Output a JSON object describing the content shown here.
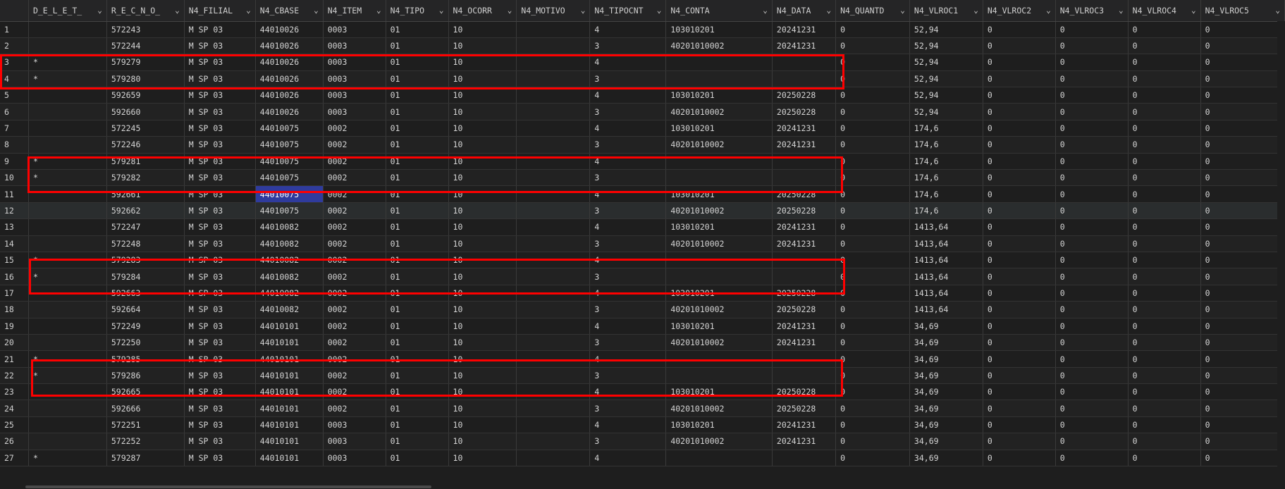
{
  "columns": [
    "",
    "D_E_L_E_T_",
    "R_E_C_N_O_",
    "N4_FILIAL",
    "N4_CBASE",
    "N4_ITEM",
    "N4_TIPO",
    "N4_OCORR",
    "N4_MOTIVO",
    "N4_TIPOCNT",
    "N4_CONTA",
    "N4_DATA",
    "N4_QUANTD",
    "N4_VLROC1",
    "N4_VLROC2",
    "N4_VLROC3",
    "N4_VLROC4",
    "N4_VLROC5"
  ],
  "rows": [
    [
      "1",
      "",
      "572243",
      "M SP 03",
      "44010026",
      "0003",
      "01",
      "10",
      "",
      "4",
      "103010201",
      "20241231",
      "0",
      "52,94",
      "0",
      "0",
      "0",
      "0"
    ],
    [
      "2",
      "",
      "572244",
      "M SP 03",
      "44010026",
      "0003",
      "01",
      "10",
      "",
      "3",
      "40201010002",
      "20241231",
      "0",
      "52,94",
      "0",
      "0",
      "0",
      "0"
    ],
    [
      "3",
      "*",
      "579279",
      "M SP 03",
      "44010026",
      "0003",
      "01",
      "10",
      "",
      "4",
      "",
      "",
      "0",
      "52,94",
      "0",
      "0",
      "0",
      "0"
    ],
    [
      "4",
      "*",
      "579280",
      "M SP 03",
      "44010026",
      "0003",
      "01",
      "10",
      "",
      "3",
      "",
      "",
      "0",
      "52,94",
      "0",
      "0",
      "0",
      "0"
    ],
    [
      "5",
      "",
      "592659",
      "M SP 03",
      "44010026",
      "0003",
      "01",
      "10",
      "",
      "4",
      "103010201",
      "20250228",
      "0",
      "52,94",
      "0",
      "0",
      "0",
      "0"
    ],
    [
      "6",
      "",
      "592660",
      "M SP 03",
      "44010026",
      "0003",
      "01",
      "10",
      "",
      "3",
      "40201010002",
      "20250228",
      "0",
      "52,94",
      "0",
      "0",
      "0",
      "0"
    ],
    [
      "7",
      "",
      "572245",
      "M SP 03",
      "44010075",
      "0002",
      "01",
      "10",
      "",
      "4",
      "103010201",
      "20241231",
      "0",
      "174,6",
      "0",
      "0",
      "0",
      "0"
    ],
    [
      "8",
      "",
      "572246",
      "M SP 03",
      "44010075",
      "0002",
      "01",
      "10",
      "",
      "3",
      "40201010002",
      "20241231",
      "0",
      "174,6",
      "0",
      "0",
      "0",
      "0"
    ],
    [
      "9",
      "*",
      "579281",
      "M SP 03",
      "44010075",
      "0002",
      "01",
      "10",
      "",
      "4",
      "",
      "",
      "0",
      "174,6",
      "0",
      "0",
      "0",
      "0"
    ],
    [
      "10",
      "*",
      "579282",
      "M SP 03",
      "44010075",
      "0002",
      "01",
      "10",
      "",
      "3",
      "",
      "",
      "0",
      "174,6",
      "0",
      "0",
      "0",
      "0"
    ],
    [
      "11",
      "",
      "592661",
      "M SP 03",
      "44010075",
      "0002",
      "01",
      "10",
      "",
      "4",
      "103010201",
      "20250228",
      "0",
      "174,6",
      "0",
      "0",
      "0",
      "0"
    ],
    [
      "12",
      "",
      "592662",
      "M SP 03",
      "44010075",
      "0002",
      "01",
      "10",
      "",
      "3",
      "40201010002",
      "20250228",
      "0",
      "174,6",
      "0",
      "0",
      "0",
      "0"
    ],
    [
      "13",
      "",
      "572247",
      "M SP 03",
      "44010082",
      "0002",
      "01",
      "10",
      "",
      "4",
      "103010201",
      "20241231",
      "0",
      "1413,64",
      "0",
      "0",
      "0",
      "0"
    ],
    [
      "14",
      "",
      "572248",
      "M SP 03",
      "44010082",
      "0002",
      "01",
      "10",
      "",
      "3",
      "40201010002",
      "20241231",
      "0",
      "1413,64",
      "0",
      "0",
      "0",
      "0"
    ],
    [
      "15",
      "*",
      "579283",
      "M SP 03",
      "44010082",
      "0002",
      "01",
      "10",
      "",
      "4",
      "",
      "",
      "0",
      "1413,64",
      "0",
      "0",
      "0",
      "0"
    ],
    [
      "16",
      "*",
      "579284",
      "M SP 03",
      "44010082",
      "0002",
      "01",
      "10",
      "",
      "3",
      "",
      "",
      "0",
      "1413,64",
      "0",
      "0",
      "0",
      "0"
    ],
    [
      "17",
      "",
      "592663",
      "M SP 03",
      "44010082",
      "0002",
      "01",
      "10",
      "",
      "4",
      "103010201",
      "20250228",
      "0",
      "1413,64",
      "0",
      "0",
      "0",
      "0"
    ],
    [
      "18",
      "",
      "592664",
      "M SP 03",
      "44010082",
      "0002",
      "01",
      "10",
      "",
      "3",
      "40201010002",
      "20250228",
      "0",
      "1413,64",
      "0",
      "0",
      "0",
      "0"
    ],
    [
      "19",
      "",
      "572249",
      "M SP 03",
      "44010101",
      "0002",
      "01",
      "10",
      "",
      "4",
      "103010201",
      "20241231",
      "0",
      "34,69",
      "0",
      "0",
      "0",
      "0"
    ],
    [
      "20",
      "",
      "572250",
      "M SP 03",
      "44010101",
      "0002",
      "01",
      "10",
      "",
      "3",
      "40201010002",
      "20241231",
      "0",
      "34,69",
      "0",
      "0",
      "0",
      "0"
    ],
    [
      "21",
      "*",
      "579285",
      "M SP 03",
      "44010101",
      "0002",
      "01",
      "10",
      "",
      "4",
      "",
      "",
      "0",
      "34,69",
      "0",
      "0",
      "0",
      "0"
    ],
    [
      "22",
      "*",
      "579286",
      "M SP 03",
      "44010101",
      "0002",
      "01",
      "10",
      "",
      "3",
      "",
      "",
      "0",
      "34,69",
      "0",
      "0",
      "0",
      "0"
    ],
    [
      "23",
      "",
      "592665",
      "M SP 03",
      "44010101",
      "0002",
      "01",
      "10",
      "",
      "4",
      "103010201",
      "20250228",
      "0",
      "34,69",
      "0",
      "0",
      "0",
      "0"
    ],
    [
      "24",
      "",
      "592666",
      "M SP 03",
      "44010101",
      "0002",
      "01",
      "10",
      "",
      "3",
      "40201010002",
      "20250228",
      "0",
      "34,69",
      "0",
      "0",
      "0",
      "0"
    ],
    [
      "25",
      "",
      "572251",
      "M SP 03",
      "44010101",
      "0003",
      "01",
      "10",
      "",
      "4",
      "103010201",
      "20241231",
      "0",
      "34,69",
      "0",
      "0",
      "0",
      "0"
    ],
    [
      "26",
      "",
      "572252",
      "M SP 03",
      "44010101",
      "0003",
      "01",
      "10",
      "",
      "3",
      "40201010002",
      "20241231",
      "0",
      "34,69",
      "0",
      "0",
      "0",
      "0"
    ],
    [
      "27",
      "*",
      "579287",
      "M SP 03",
      "44010101",
      "0003",
      "01",
      "10",
      "",
      "4",
      "",
      "",
      "0",
      "34,69",
      "0",
      "0",
      "0",
      "0"
    ]
  ],
  "selected_cell": {
    "row": 10,
    "col": 4
  },
  "hover_row": 11,
  "colors": {
    "background": "#1e1e1e",
    "highlight": "#ff0000",
    "selection": "#2f3b9d"
  },
  "icons": {
    "column_menu": "chevron-down-icon"
  }
}
